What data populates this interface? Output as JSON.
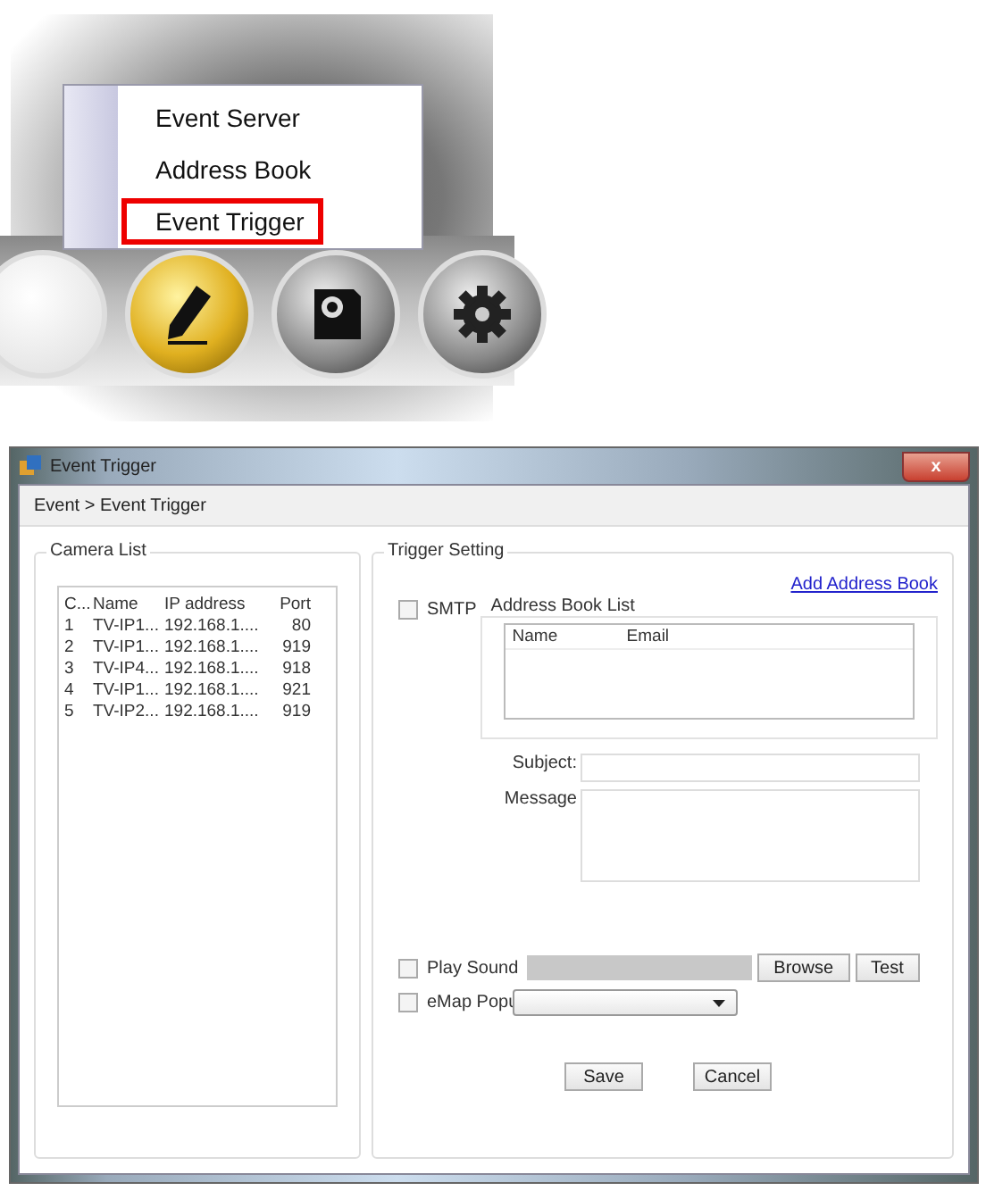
{
  "toolbar": {
    "buttons": [
      {
        "kind": "other",
        "selected": false
      },
      {
        "kind": "edit",
        "selected": true
      },
      {
        "kind": "camera",
        "selected": false
      },
      {
        "kind": "settings",
        "selected": false
      }
    ],
    "menu": {
      "items": [
        {
          "label": "Event Server",
          "highlighted": false
        },
        {
          "label": "Address Book",
          "highlighted": false
        },
        {
          "label": "Event Trigger",
          "highlighted": true
        }
      ]
    }
  },
  "window": {
    "title": "Event Trigger",
    "close": "x",
    "breadcrumb": "Event > Event Trigger",
    "camera_list": {
      "title": "Camera List",
      "columns": [
        "C...",
        "Name",
        "IP address",
        "Port"
      ],
      "rows": [
        [
          "1",
          "TV-IP1...",
          "192.168.1....",
          "80"
        ],
        [
          "2",
          "TV-IP1...",
          "192.168.1....",
          "919"
        ],
        [
          "3",
          "TV-IP4...",
          "192.168.1....",
          "918"
        ],
        [
          "4",
          "TV-IP1...",
          "192.168.1....",
          "921"
        ],
        [
          "5",
          "TV-IP2...",
          "192.168.1....",
          "919"
        ]
      ]
    },
    "trigger": {
      "title": "Trigger Setting",
      "add_link": "Add Address Book",
      "smtp": {
        "label": "SMTP",
        "checked": false
      },
      "address_book": {
        "title": "Address Book List",
        "columns": [
          "Name",
          "Email"
        ]
      },
      "subject_label": "Subject:",
      "message_label": "Message",
      "play_sound": {
        "label": "Play Sound",
        "checked": false
      },
      "browse": "Browse",
      "test": "Test",
      "emap": {
        "label": "eMap Popu",
        "checked": false
      },
      "save": "Save",
      "cancel": "Cancel"
    }
  }
}
